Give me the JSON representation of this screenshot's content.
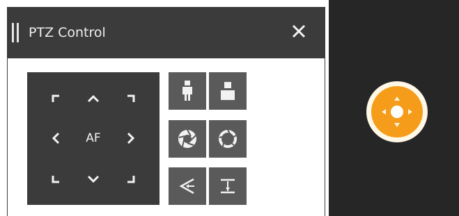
{
  "window": {
    "title": "PTZ Control",
    "close_icon": "close-icon",
    "grip_icon": "drag-grip-icon"
  },
  "ptz": {
    "af_label": "AF",
    "direction_icons": [
      "up-left-icon",
      "up-icon",
      "up-right-icon",
      "left-icon",
      "right-icon",
      "down-left-icon",
      "down-icon",
      "down-right-icon"
    ]
  },
  "buttons": {
    "zoom_in_icon": "person-full-body-icon",
    "zoom_out_icon": "person-bust-icon",
    "iris_open_icon": "aperture-open-icon",
    "iris_close_icon": "aperture-closed-icon",
    "focus_near_icon": "focus-near-icon",
    "focus_far_icon": "focus-far-icon"
  },
  "colors": {
    "header_bg": "#3b3b3b",
    "button_bg": "#5a5a5a",
    "joystick_accent": "#f59c1a",
    "video_bg": "#262626"
  }
}
